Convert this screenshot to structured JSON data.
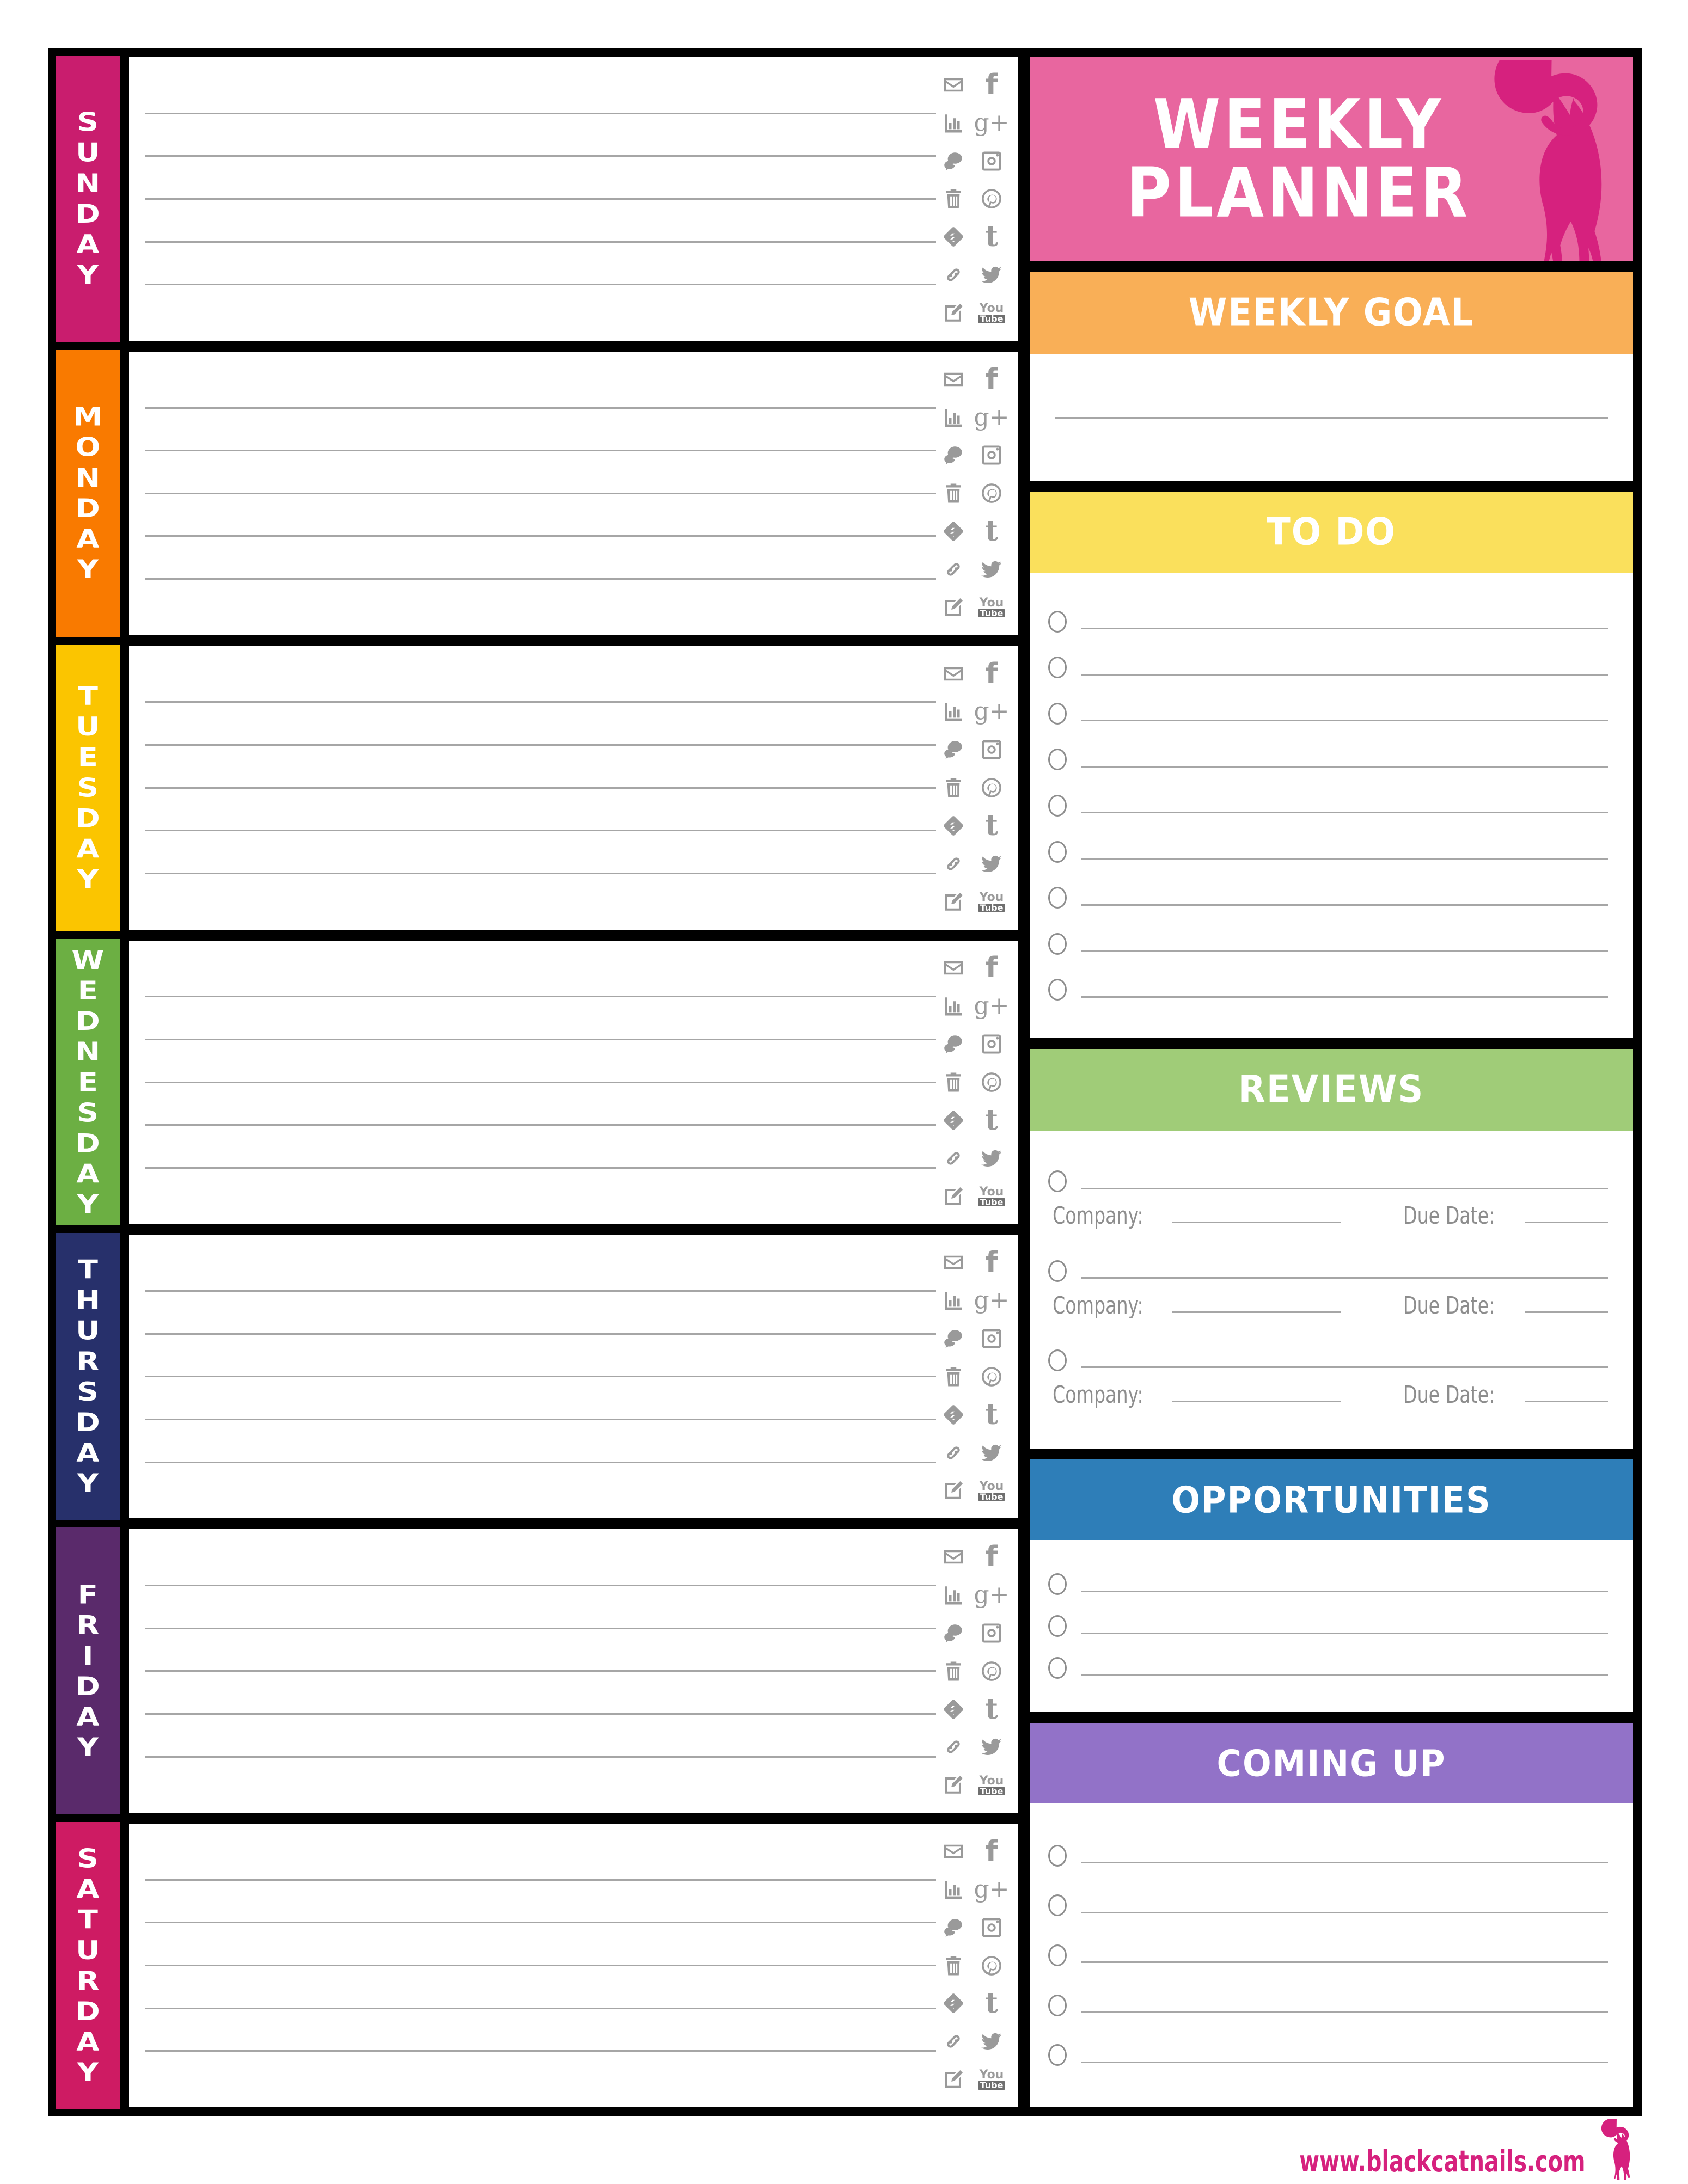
{
  "header": {
    "title_line1": "WEEKLY",
    "title_line2": "PLANNER",
    "background_color": "#E8669F",
    "cat_color": "#D6217E",
    "cat_icon": "cat-silhouette-icon"
  },
  "days": [
    {
      "label": "SUNDAY",
      "color": "#C91D6E",
      "lines": 5
    },
    {
      "label": "MONDAY",
      "color": "#F97A00",
      "lines": 5
    },
    {
      "label": "TUESDAY",
      "color": "#FBC500",
      "lines": 5
    },
    {
      "label": "WEDNESDAY",
      "color": "#6CAF43",
      "lines": 5
    },
    {
      "label": "THURSDAY",
      "color": "#27306B",
      "lines": 5
    },
    {
      "label": "FRIDAY",
      "color": "#5A2A6B",
      "lines": 5
    },
    {
      "label": "SATURDAY",
      "color": "#CE1B63",
      "lines": 5
    }
  ],
  "social_icons": {
    "color": "#9a9a9a",
    "left_column": [
      "email-icon",
      "analytics-bar-chart-icon",
      "comments-speech-bubble-icon",
      "trash-can-icon",
      "feedly-icon",
      "link-chain-icon",
      "edit-pencil-icon"
    ],
    "right_column": [
      "facebook-icon",
      "google-plus-icon",
      "instagram-icon",
      "pinterest-icon",
      "tumblr-icon",
      "twitter-icon",
      "youtube-icon"
    ],
    "glyphs": {
      "facebook": "f",
      "google_plus": "g+",
      "tumblr": "t",
      "youtube_top": "You",
      "youtube_bottom": "Tube"
    }
  },
  "sections": {
    "weekly_goal": {
      "title": "WEEKLY GOAL",
      "color": "#F9AF57",
      "lines": 1
    },
    "to_do": {
      "title": "TO DO",
      "color": "#FAE05C",
      "items": 9
    },
    "reviews": {
      "title": "REVIEWS",
      "color": "#A0CC78",
      "items": 3,
      "company_label": "Company:",
      "due_date_label": "Due Date:"
    },
    "opportunities": {
      "title": "OPPORTUNITIES",
      "color": "#2E7EB8",
      "items": 3
    },
    "coming_up": {
      "title": "COMING UP",
      "color": "#9272C8",
      "items": 5
    }
  },
  "footer": {
    "url": "www.blackcatnails.com",
    "url_color": "#D6217E",
    "cat_icon": "cat-silhouette-icon"
  }
}
